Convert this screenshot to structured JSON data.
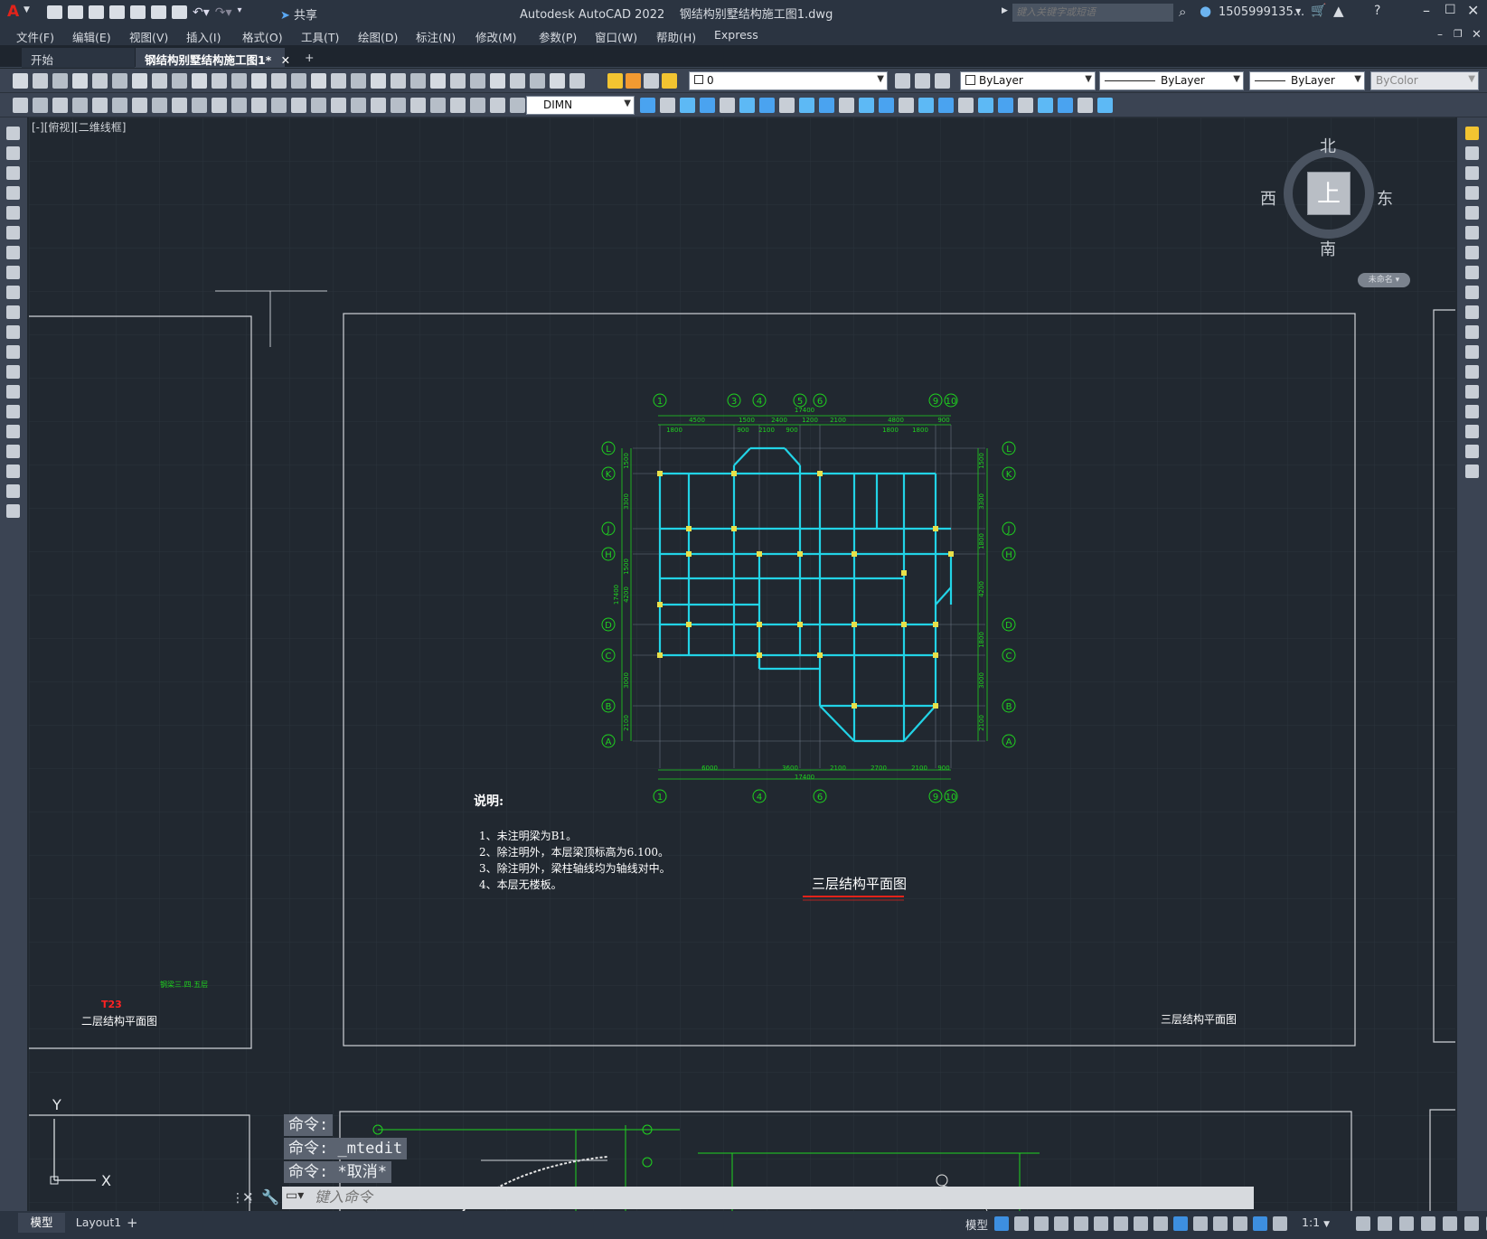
{
  "app": {
    "title": "Autodesk AutoCAD 2022",
    "filename": "钢结构别墅结构施工图1.dwg",
    "share_label": "共享",
    "search_placeholder": "键入关键字或短语",
    "user": "1505999135...",
    "logo_letter": "A"
  },
  "menu": [
    "文件(F)",
    "编辑(E)",
    "视图(V)",
    "插入(I)",
    "格式(O)",
    "工具(T)",
    "绘图(D)",
    "标注(N)",
    "修改(M)",
    "参数(P)",
    "窗口(W)",
    "帮助(H)",
    "Express"
  ],
  "tabs": {
    "start": "开始",
    "active": "钢结构别墅结构施工图1*",
    "add": "+"
  },
  "properties": {
    "layer": "0",
    "color": "ByLayer",
    "linetype": "ByLayer",
    "lineweight": "ByLayer",
    "plotstyle": "ByColor",
    "dimstyle": "DIMN"
  },
  "viewport_label": "[-][俯视][二维线框]",
  "viewcube": {
    "north": "北",
    "south": "南",
    "east": "东",
    "west": "西",
    "top": "上",
    "wcs": "未命名"
  },
  "drawing": {
    "title": "三层结构平面图",
    "notes_heading": "说明:",
    "notes": [
      "1、未注明梁为B1。",
      "2、除注明外，本层梁顶标高为6.100。",
      "3、除注明外，梁柱轴线均为轴线对中。",
      "4、本层无楼板。"
    ],
    "frame_caption": "三层结构平面图",
    "left_caption": "二层结构平面图",
    "left_small_red": "T23",
    "left_green": "钢梁三.四.五层",
    "axis_top": [
      "1",
      "3",
      "4",
      "5",
      "6",
      "9",
      "10"
    ],
    "axis_bottom": [
      "1",
      "4",
      "6",
      "9",
      "10"
    ],
    "axis_rows": [
      "L",
      "K",
      "J",
      "H",
      "D",
      "C",
      "B",
      "A"
    ],
    "dim_top_total": "17400",
    "dim_top": [
      "4500",
      "1500",
      "2400",
      "1200",
      "2100",
      "4800",
      "900"
    ],
    "dim_top2": [
      "1800",
      "900",
      "2100",
      "900",
      "1800",
      "1800"
    ],
    "dim_bottom": [
      "6000",
      "3600",
      "2100",
      "2700",
      "2100",
      "900"
    ],
    "dim_bottom_total": "17400",
    "dim_left_total": "17400",
    "dim_left": [
      "1500",
      "3300",
      "1500",
      "4200",
      "3000",
      "2100"
    ],
    "dim_right": [
      "1500",
      "3300",
      "1800",
      "4200",
      "1800",
      "3000",
      "2100"
    ],
    "ucs_x": "X",
    "ucs_y": "Y"
  },
  "command": {
    "history": [
      "命令:",
      "命令: _mtedit",
      "命令: *取消*"
    ],
    "placeholder": "键入命令"
  },
  "status": {
    "tab_model": "模型",
    "tab_layout": "Layout1",
    "mode": "模型",
    "scale": "1:1"
  }
}
